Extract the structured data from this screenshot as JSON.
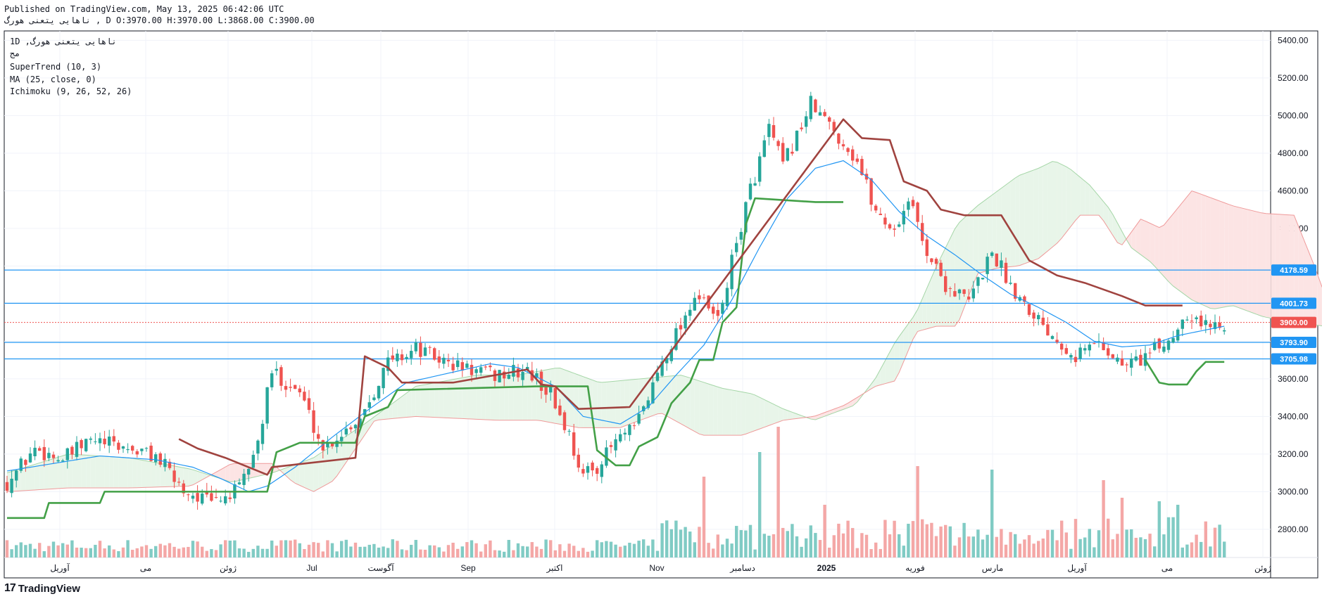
{
  "header": {
    "published": "Published on TradingView.com, May 13, 2025 06:42:06 UTC",
    "ohlc": "ناهایی یتعنی هورگ , D O:3970.00 H:3970.00 L:3868.00 C:3900.00"
  },
  "legend": {
    "line1": "1D ,ناهایی یتعنی هورگ",
    "line2": "مج",
    "line3": "SuperTrend (10, 3)",
    "line4": "MA (25, close, 0)",
    "line5": "Ichimoku (9, 26, 52, 26)"
  },
  "footer": {
    "logo_mark": "17",
    "logo_text": "TradingView"
  },
  "colors": {
    "up": "#26a69a",
    "down": "#ef5350",
    "vol_up": "#80cbc4",
    "vol_down": "#f4a7a6",
    "supertrend_up": "#43a047",
    "supertrend_down": "#a0433f",
    "ma": "#2196f3",
    "cloud_bull": "#e8f5e9",
    "cloud_bear": "#fce4e4",
    "hline": "#2196f3"
  },
  "chart_data": {
    "type": "candlestick",
    "ylim": [
      2650,
      5450
    ],
    "y_ticks": [
      5400,
      5200,
      5000,
      4800,
      4600,
      4400,
      4200,
      4000,
      3800,
      3600,
      3400,
      3200,
      3000,
      2800
    ],
    "x_labels": [
      "آوریل",
      "می",
      "ژوئن",
      "Jul",
      "آگوست",
      "Sep",
      "اکتبر",
      "Nov",
      "دسامبر",
      "2025",
      "فوریه",
      "مارس",
      "آوریل",
      "می",
      "ژوئن"
    ],
    "price_lines": [
      {
        "value": 4178.59,
        "label": "4178.59",
        "color": "#2196f3"
      },
      {
        "value": 4001.73,
        "label": "4001.73",
        "color": "#2196f3"
      },
      {
        "value": 3900.0,
        "label": "3900.00",
        "color": "#ef5350",
        "dotted": true
      },
      {
        "value": 3793.9,
        "label": "3793.90",
        "color": "#2196f3"
      },
      {
        "value": 3705.98,
        "label": "3705.98",
        "color": "#2196f3"
      }
    ],
    "close_anchors": [
      [
        0,
        3050
      ],
      [
        6,
        3230
      ],
      [
        12,
        3170
      ],
      [
        18,
        3270
      ],
      [
        26,
        3230
      ],
      [
        32,
        3190
      ],
      [
        38,
        3010
      ],
      [
        44,
        2940
      ],
      [
        50,
        3010
      ],
      [
        54,
        3260
      ],
      [
        57,
        3640
      ],
      [
        63,
        3530
      ],
      [
        68,
        3230
      ],
      [
        76,
        3400
      ],
      [
        82,
        3690
      ],
      [
        88,
        3760
      ],
      [
        95,
        3680
      ],
      [
        104,
        3620
      ],
      [
        112,
        3640
      ],
      [
        117,
        3520
      ],
      [
        121,
        3300
      ],
      [
        124,
        3080
      ],
      [
        128,
        3160
      ],
      [
        131,
        3270
      ],
      [
        135,
        3330
      ],
      [
        138,
        3500
      ],
      [
        141,
        3700
      ],
      [
        146,
        3940
      ],
      [
        148,
        4050
      ],
      [
        153,
        3910
      ],
      [
        159,
        4520
      ],
      [
        164,
        4930
      ],
      [
        167,
        4730
      ],
      [
        173,
        5060
      ],
      [
        178,
        4920
      ],
      [
        183,
        4760
      ],
      [
        187,
        4490
      ],
      [
        191,
        4390
      ],
      [
        194,
        4560
      ],
      [
        198,
        4280
      ],
      [
        202,
        4100
      ],
      [
        207,
        4010
      ],
      [
        212,
        4280
      ],
      [
        216,
        4100
      ],
      [
        220,
        3980
      ],
      [
        225,
        3840
      ],
      [
        230,
        3730
      ],
      [
        235,
        3800
      ],
      [
        240,
        3670
      ],
      [
        245,
        3720
      ],
      [
        250,
        3800
      ],
      [
        254,
        3960
      ],
      [
        258,
        3880
      ],
      [
        262,
        3900
      ]
    ],
    "supertrend": {
      "up": [
        [
          0,
          2860
        ],
        [
          8,
          2860
        ],
        [
          9,
          2940
        ],
        [
          20,
          2940
        ],
        [
          21,
          3000
        ],
        [
          39,
          3000
        ],
        [
          56,
          3000
        ],
        [
          58,
          3210
        ],
        [
          63,
          3260
        ],
        [
          75,
          3260
        ],
        [
          77,
          3400
        ],
        [
          82,
          3450
        ],
        [
          84,
          3540
        ],
        [
          114,
          3560
        ],
        [
          125,
          3560
        ],
        [
          127,
          3220
        ],
        [
          131,
          3140
        ],
        [
          134,
          3140
        ],
        [
          136,
          3240
        ],
        [
          140,
          3290
        ],
        [
          143,
          3470
        ],
        [
          147,
          3580
        ],
        [
          149,
          3700
        ],
        [
          152,
          3700
        ],
        [
          154,
          3900
        ],
        [
          157,
          3980
        ],
        [
          159,
          4420
        ],
        [
          161,
          4560
        ],
        [
          174,
          4540
        ],
        [
          180,
          4540
        ]
      ],
      "down": [
        [
          37,
          3280
        ],
        [
          41,
          3230
        ],
        [
          47,
          3180
        ],
        [
          56,
          3090
        ],
        [
          57,
          3130
        ],
        [
          75,
          3180
        ],
        [
          77,
          3720
        ],
        [
          82,
          3660
        ],
        [
          85,
          3580
        ],
        [
          96,
          3580
        ],
        [
          112,
          3650
        ],
        [
          115,
          3570
        ],
        [
          118,
          3560
        ],
        [
          123,
          3440
        ],
        [
          134,
          3450
        ],
        [
          180,
          4980
        ],
        [
          184,
          4880
        ],
        [
          190,
          4870
        ],
        [
          193,
          4650
        ],
        [
          198,
          4600
        ],
        [
          201,
          4500
        ],
        [
          206,
          4470
        ],
        [
          214,
          4470
        ],
        [
          220,
          4230
        ],
        [
          226,
          4150
        ],
        [
          232,
          4110
        ],
        [
          240,
          4040
        ],
        [
          245,
          3990
        ],
        [
          253,
          3990
        ]
      ],
      "up2": [
        [
          245,
          3700
        ],
        [
          248,
          3580
        ],
        [
          250,
          3570
        ],
        [
          254,
          3570
        ],
        [
          256,
          3640
        ],
        [
          258,
          3690
        ],
        [
          262,
          3690
        ]
      ]
    },
    "ma": [
      [
        0,
        3110
      ],
      [
        10,
        3150
      ],
      [
        20,
        3190
      ],
      [
        32,
        3170
      ],
      [
        40,
        3130
      ],
      [
        46,
        3070
      ],
      [
        52,
        3000
      ],
      [
        56,
        3030
      ],
      [
        62,
        3130
      ],
      [
        70,
        3290
      ],
      [
        78,
        3440
      ],
      [
        86,
        3580
      ],
      [
        95,
        3630
      ],
      [
        104,
        3680
      ],
      [
        110,
        3660
      ],
      [
        118,
        3560
      ],
      [
        124,
        3400
      ],
      [
        132,
        3360
      ],
      [
        138,
        3450
      ],
      [
        144,
        3620
      ],
      [
        150,
        3780
      ],
      [
        156,
        4020
      ],
      [
        162,
        4300
      ],
      [
        168,
        4560
      ],
      [
        174,
        4720
      ],
      [
        180,
        4760
      ],
      [
        186,
        4660
      ],
      [
        192,
        4490
      ],
      [
        198,
        4360
      ],
      [
        204,
        4260
      ],
      [
        210,
        4150
      ],
      [
        216,
        4050
      ],
      [
        222,
        3980
      ],
      [
        228,
        3900
      ],
      [
        234,
        3800
      ],
      [
        240,
        3770
      ],
      [
        246,
        3780
      ],
      [
        252,
        3830
      ],
      [
        262,
        3880
      ]
    ],
    "cloud_a": [
      [
        0,
        3100
      ],
      [
        12,
        3200
      ],
      [
        24,
        3180
      ],
      [
        36,
        3120
      ],
      [
        44,
        3050
      ],
      [
        52,
        3100
      ],
      [
        60,
        3180
      ],
      [
        70,
        3360
      ],
      [
        80,
        3560
      ],
      [
        92,
        3620
      ],
      [
        100,
        3620
      ],
      [
        108,
        3660
      ],
      [
        116,
        3580
      ],
      [
        124,
        3600
      ],
      [
        132,
        3620
      ],
      [
        140,
        3550
      ],
      [
        146,
        3520
      ],
      [
        152,
        3440
      ],
      [
        158,
        3380
      ],
      [
        166,
        3460
      ],
      [
        170,
        3600
      ],
      [
        174,
        3800
      ],
      [
        178,
        3950
      ],
      [
        182,
        4200
      ],
      [
        186,
        4420
      ],
      [
        190,
        4520
      ],
      [
        194,
        4600
      ],
      [
        198,
        4680
      ],
      [
        202,
        4720
      ],
      [
        205,
        4760
      ],
      [
        208,
        4720
      ],
      [
        212,
        4630
      ],
      [
        216,
        4500
      ],
      [
        220,
        4300
      ],
      [
        224,
        4220
      ],
      [
        228,
        4100
      ],
      [
        232,
        4020
      ],
      [
        236,
        3970
      ],
      [
        240,
        3990
      ],
      [
        246,
        3930
      ],
      [
        252,
        3900
      ],
      [
        258,
        3880
      ],
      [
        262,
        3880
      ]
    ],
    "cloud_b": [
      [
        0,
        3000
      ],
      [
        12,
        3020
      ],
      [
        24,
        3020
      ],
      [
        36,
        3030
      ],
      [
        44,
        3150
      ],
      [
        52,
        3150
      ],
      [
        56,
        3050
      ],
      [
        60,
        3000
      ],
      [
        64,
        3060
      ],
      [
        72,
        3380
      ],
      [
        80,
        3400
      ],
      [
        88,
        3390
      ],
      [
        96,
        3380
      ],
      [
        104,
        3380
      ],
      [
        112,
        3340
      ],
      [
        120,
        3340
      ],
      [
        128,
        3420
      ],
      [
        136,
        3300
      ],
      [
        144,
        3300
      ],
      [
        152,
        3380
      ],
      [
        158,
        3400
      ],
      [
        164,
        3460
      ],
      [
        170,
        3560
      ],
      [
        174,
        3590
      ],
      [
        178,
        3850
      ],
      [
        182,
        3880
      ],
      [
        186,
        3880
      ],
      [
        190,
        4160
      ],
      [
        194,
        4190
      ],
      [
        198,
        4200
      ],
      [
        202,
        4240
      ],
      [
        206,
        4330
      ],
      [
        210,
        4470
      ],
      [
        214,
        4470
      ],
      [
        218,
        4300
      ],
      [
        222,
        4450
      ],
      [
        226,
        4400
      ],
      [
        232,
        4600
      ],
      [
        236,
        4560
      ],
      [
        240,
        4520
      ],
      [
        246,
        4480
      ],
      [
        252,
        4470
      ],
      [
        256,
        4200
      ],
      [
        258,
        4050
      ],
      [
        262,
        3960
      ]
    ]
  }
}
